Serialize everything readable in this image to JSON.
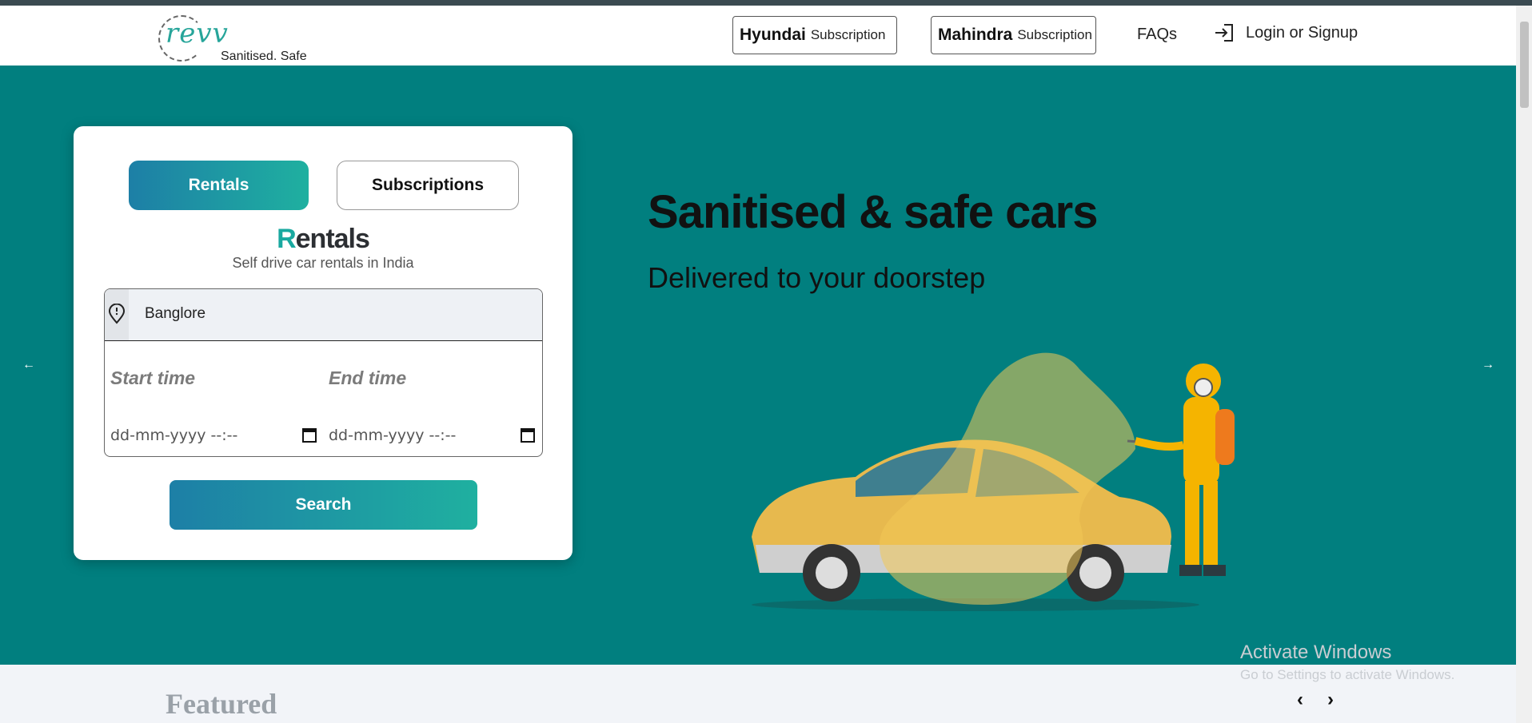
{
  "header": {
    "logo_text": "revv",
    "tagline": "Sanitised. Safe",
    "hyundai": {
      "brand": "Hyundai",
      "label": "Subscription"
    },
    "mahindra": {
      "brand": "Mahindra",
      "label": "Subscription"
    },
    "faqs": "FAQs",
    "login": "Login or Signup"
  },
  "card": {
    "tabs": [
      "Rentals",
      "Subscriptions"
    ],
    "title_first": "R",
    "title_rest": "entals",
    "subtitle": "Self drive car rentals in India",
    "location": "Banglore",
    "start_label": "Start time",
    "end_label": "End time",
    "start_value": "dd-mm-yyyy --:--",
    "end_value": "dd-mm-yyyy --:--",
    "search": "Search"
  },
  "hero": {
    "heading": "Sanitised & safe cars",
    "subheading": "Delivered to your doorstep",
    "prev_arrow": "←",
    "next_arrow": "→"
  },
  "featured": {
    "title": "Featured",
    "prev": "‹",
    "next": "›"
  },
  "watermark": {
    "line1": "Activate Windows",
    "line2": "Go to Settings to activate Windows."
  },
  "colors": {
    "hero_bg": "#017f7f",
    "accent": "#1aa9a0",
    "gradient_start": "#1d7fa6",
    "gradient_end": "#1fb0a0"
  }
}
